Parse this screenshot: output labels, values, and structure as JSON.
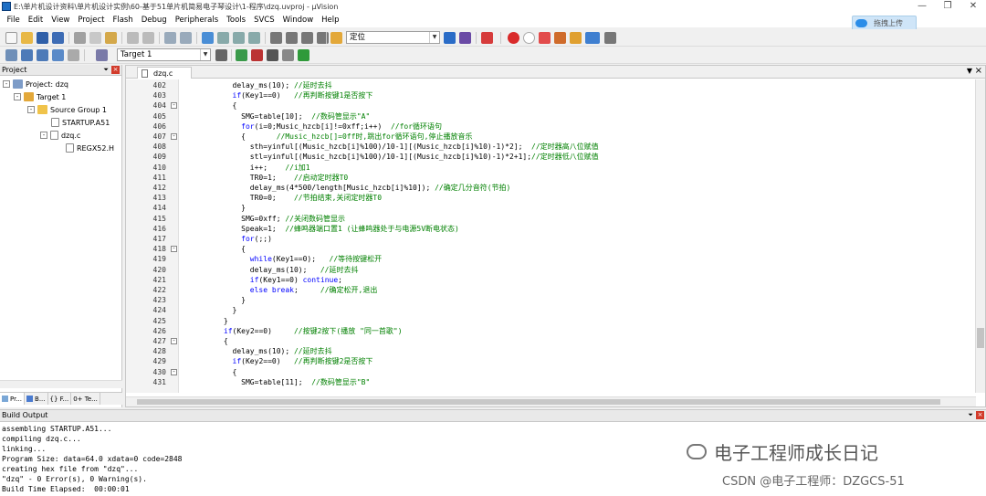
{
  "window": {
    "title": "E:\\单片机设计资料\\单片机设计实例\\60-基于51单片机简易电子琴设计\\1-程序\\dzq.uvproj - µVision"
  },
  "menu": [
    "File",
    "Edit",
    "View",
    "Project",
    "Flash",
    "Debug",
    "Peripherals",
    "Tools",
    "SVCS",
    "Window",
    "Help"
  ],
  "upload_button": "拖拽上传",
  "toolbar": {
    "find_value": "定位",
    "target": "Target 1"
  },
  "project": {
    "title": "Project",
    "root": "Project: dzq",
    "target": "Target 1",
    "group": "Source Group 1",
    "files": [
      "STARTUP.A51",
      "dzq.c",
      "REGX52.H"
    ],
    "tabs": [
      "Pr...",
      "B...",
      "{} F...",
      "0+ Te..."
    ]
  },
  "editor": {
    "tab": "dzq.c",
    "lines": [
      {
        "n": "402",
        "t": "        delay_ms(10); //延时去抖"
      },
      {
        "n": "403",
        "t": "        if(Key1==0)   //再判断按键1是否按下"
      },
      {
        "n": "404",
        "t": "        {"
      },
      {
        "n": "405",
        "t": "          SMG=table[10];  //数码管显示\"A\""
      },
      {
        "n": "406",
        "t": "          for(i=0;Music_hzcb[i]!=0xff;i++)  //for循环语句"
      },
      {
        "n": "407",
        "t": "          {       //Music_hzcb[]=0ff时,跳出for循环语句,停止播放音乐"
      },
      {
        "n": "408",
        "t": "            sth=yinful[(Music_hzcb[i]%100)/10-1][(Music_hzcb[i]%10)-1)*2];  //定时器高八位赋值"
      },
      {
        "n": "409",
        "t": "            stl=yinful[(Music_hzcb[i]%100)/10-1][(Music_hzcb[i]%10)-1)*2+1];//定时器低八位赋值"
      },
      {
        "n": "410",
        "t": "            i++;    //i加1"
      },
      {
        "n": "411",
        "t": "            TR0=1;    //启动定时器T0"
      },
      {
        "n": "412",
        "t": "            delay_ms(4*500/length[Music_hzcb[i]%10]); //确定几分音符(节拍)"
      },
      {
        "n": "413",
        "t": "            TR0=0;    //节拍结束,关闭定时器T0"
      },
      {
        "n": "414",
        "t": "          }"
      },
      {
        "n": "415",
        "t": "          SMG=0xff; //关闭数码管显示"
      },
      {
        "n": "416",
        "t": "          Speak=1;  //蜂鸣器端口置1 (让蜂鸣器处于与电源5V断电状态)"
      },
      {
        "n": "417",
        "t": "          for(;;)"
      },
      {
        "n": "418",
        "t": "          {"
      },
      {
        "n": "419",
        "t": "            while(Key1==0);   //等待按键松开"
      },
      {
        "n": "420",
        "t": "            delay_ms(10);   //延时去抖"
      },
      {
        "n": "421",
        "t": "            if(Key1==0) continue;"
      },
      {
        "n": "422",
        "t": "            else break;     //确定松开,退出"
      },
      {
        "n": "423",
        "t": "          }"
      },
      {
        "n": "424",
        "t": "        }"
      },
      {
        "n": "425",
        "t": "      }"
      },
      {
        "n": "426",
        "t": "      if(Key2==0)     //按键2按下(播放 \"同一首歌\")"
      },
      {
        "n": "427",
        "t": "      {"
      },
      {
        "n": "428",
        "t": "        delay_ms(10); //延时去抖"
      },
      {
        "n": "429",
        "t": "        if(Key2==0)   //再判断按键2是否按下"
      },
      {
        "n": "430",
        "t": "        {"
      },
      {
        "n": "431",
        "t": "          SMG=table[11];  //数码管显示\"B\""
      }
    ]
  },
  "build": {
    "title": "Build Output",
    "lines": [
      "assembling STARTUP.A51...",
      "compiling dzq.c...",
      "linking...",
      "Program Size: data=64.0 xdata=0 code=2848",
      "creating hex file from \"dzq\"...",
      "\"dzq\" - 0 Error(s), 0 Warning(s).",
      "Build Time Elapsed:  00:00:01"
    ]
  },
  "watermark": {
    "line1": "电子工程师成长日记",
    "line2": "CSDN @电子工程师：DZGCS-51"
  },
  "colors": {
    "keyword": "#0000ff",
    "comment": "#008000",
    "number": "#800080"
  }
}
